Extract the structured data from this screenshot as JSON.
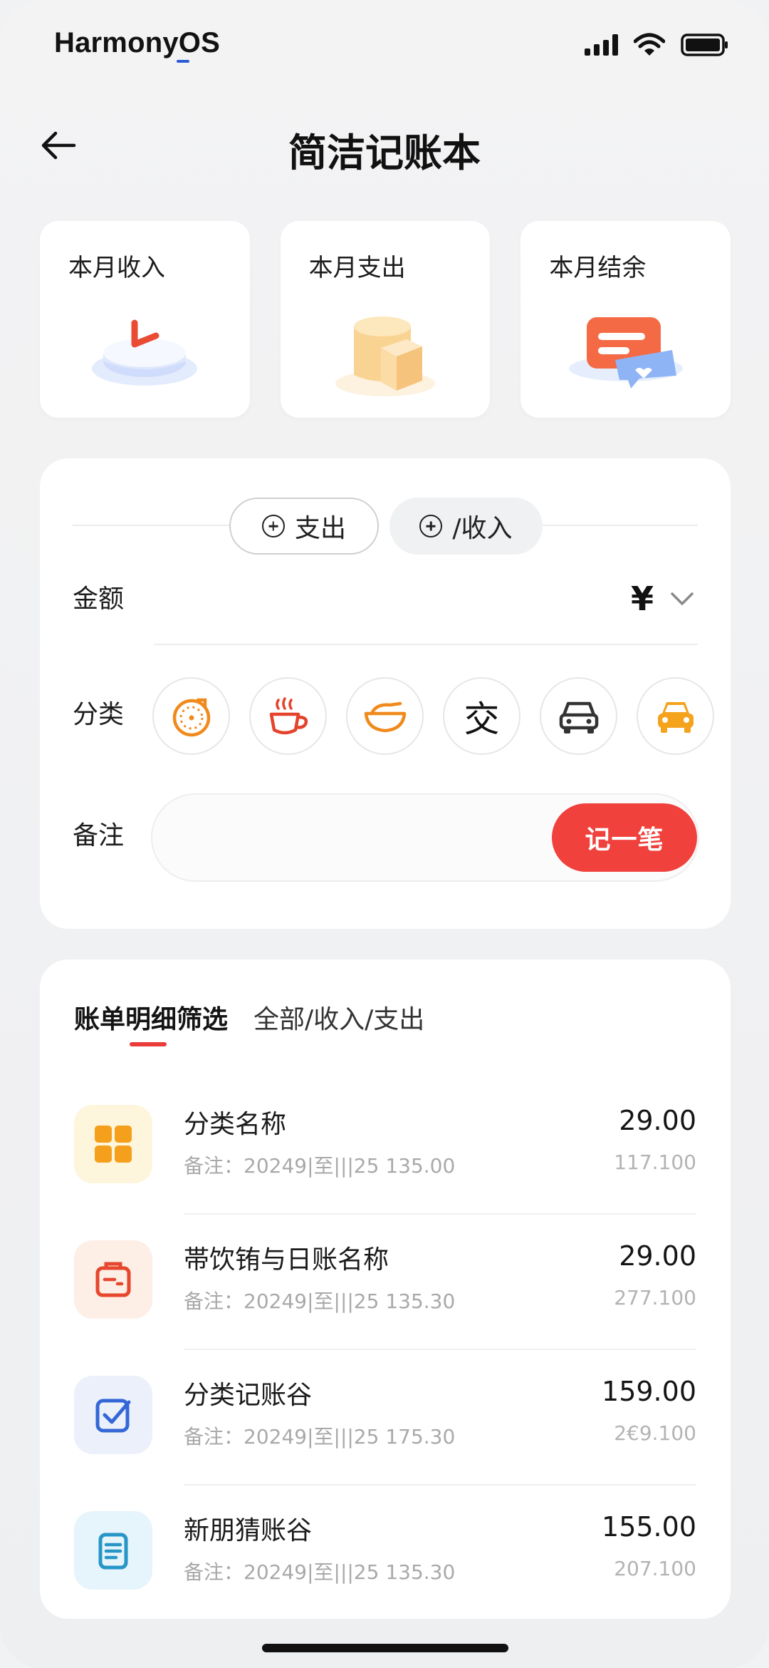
{
  "status_bar": {
    "brand": "HarmonyOS"
  },
  "header": {
    "title": "简洁记账本"
  },
  "summary": [
    {
      "label": "本月收入",
      "icon": "income-illustration"
    },
    {
      "label": "本月支出",
      "icon": "expense-illustration"
    },
    {
      "label": "本月结余",
      "icon": "balance-illustration"
    }
  ],
  "entry": {
    "tabs": {
      "expense": "支出",
      "income": "/收入"
    },
    "amount_label": "金额",
    "currency": "¥",
    "category_label": "分类",
    "categories": [
      {
        "icon": "timer-icon"
      },
      {
        "icon": "coffee-icon"
      },
      {
        "icon": "bowl-icon"
      },
      {
        "glyph": "交"
      },
      {
        "icon": "car-icon"
      },
      {
        "icon": "taxi-icon"
      }
    ],
    "note_label": "备注",
    "note_value": "",
    "record_button": "记一笔"
  },
  "bills": {
    "filter_title": "账单明细筛选",
    "filter_options": "全部/收入/支出",
    "items": [
      {
        "name": "分类名称",
        "note": "备注：20249|至|||25  135.00",
        "amount": "29.00",
        "sub": "117.100"
      },
      {
        "name": "帯饮铕与日账名称",
        "note": "备注：20249|至|||25  135.30",
        "amount": "29.00",
        "sub": "277.100"
      },
      {
        "name": "分类记账谷",
        "note": "备注：20249|至|||25  175.30",
        "amount": "159.00",
        "sub": "2€9.100"
      },
      {
        "name": "新朋猜账谷",
        "note": "备注：20249|至|||25  135.30",
        "amount": "155.00",
        "sub": "207.100"
      }
    ]
  },
  "colors": {
    "accent": "#f0413c",
    "brand_underline": "#2a5bd7"
  }
}
